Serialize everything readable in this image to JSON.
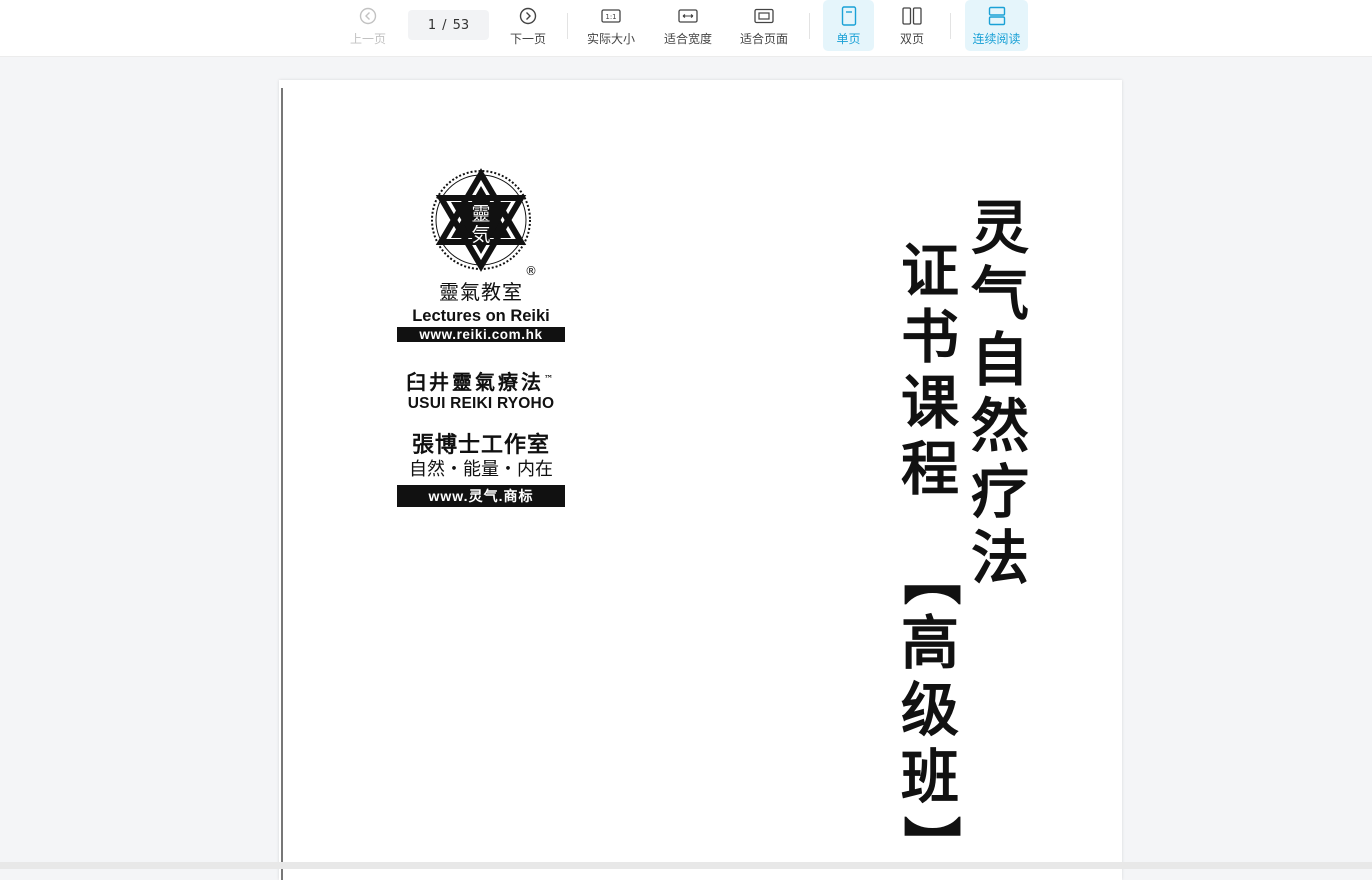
{
  "toolbar": {
    "prev_label": "上一页",
    "next_label": "下一页",
    "current_page": "1",
    "page_separator": "/",
    "total_pages": "53",
    "actual_size_label": "实际大小",
    "actual_size_icon_text": "1:1",
    "fit_width_label": "适合宽度",
    "fit_page_label": "适合页面",
    "single_page_label": "单页",
    "double_page_label": "双页",
    "continuous_label": "连续阅读",
    "active_view": "single_page",
    "accent_color": "#1aa1d6",
    "active_bg": "#e5f5fb"
  },
  "document": {
    "seal_chars": [
      "靈",
      "気"
    ],
    "seal_mark": "®",
    "seal_cn": "靈氣教室",
    "seal_en": "Lectures on Reiki",
    "seal_url": "www.reiki.com.hk",
    "usui_cn": "臼井靈氣療法",
    "usui_tm": "™",
    "usui_en": "USUI REIKI RYOHO",
    "studio_cn": "張博士工作室",
    "studio_sub": "自然・能量・内在",
    "studio_url": "www.灵气.商标",
    "title_line1": [
      "灵",
      "气",
      "自",
      "然",
      "疗",
      "法"
    ],
    "title_line2": [
      "证",
      "书",
      "课",
      "程"
    ],
    "title_line3": [
      "【",
      "高",
      "级",
      "班",
      "】"
    ]
  }
}
